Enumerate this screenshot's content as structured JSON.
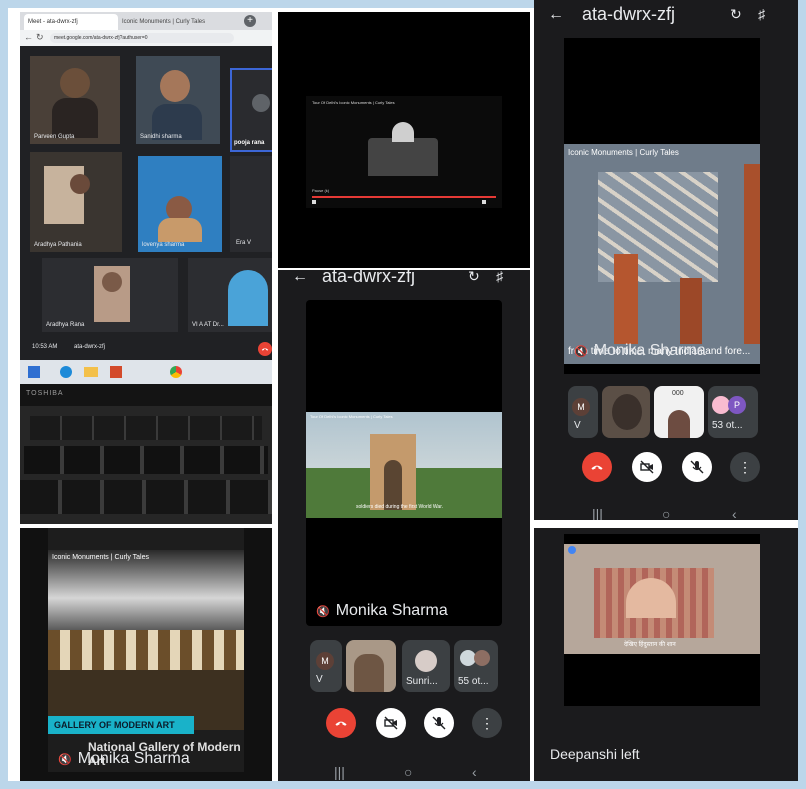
{
  "laptop": {
    "tab_title": "Meet - ata-dwrx-zfj",
    "tab2_title": "Iconic Monuments | Curly Tales",
    "url": "meet.google.com/ata-dwrx-zfj?authuser=0",
    "participants": [
      "Parveen Gupta",
      "Sanidhi sharma",
      "pooja rana",
      "Aradhya Pathania",
      "lovenya sharma",
      "Era V",
      "Aradhya Rana",
      "VI A AT Dr..."
    ],
    "time": "10:53 AM",
    "meeting_code": "ata-dwrx-zfj",
    "brand": "TOSHIBA"
  },
  "panel2": {
    "video_title": "Tour Of Delhi's Iconic Monuments | Curly Tales",
    "subtitle": "Pause (k)"
  },
  "phone_center": {
    "header": "ata-dwrx-zfj",
    "video_title": "Tour Of Delhi's Iconic Monuments | Curly Tales",
    "caption": "soldiers died during the first World War.",
    "presenter": "Monika Sharma",
    "tiles": [
      {
        "label": "V",
        "initial": "M"
      },
      {
        "label": ""
      },
      {
        "label": "Sunri..."
      },
      {
        "label": "55 ot..."
      }
    ]
  },
  "phone_right": {
    "header": "ata-dwrx-zfj",
    "video_title": "Iconic Monuments | Curly Tales",
    "caption": "from time to time, many Indian and fore...",
    "presenter": "Monika Sharma",
    "tiles": [
      {
        "label": "V",
        "initial": "M"
      },
      {
        "label": ""
      },
      {
        "label": "000"
      },
      {
        "label": "53 ot...",
        "initial": "P"
      }
    ]
  },
  "panel_gallery": {
    "video_title": "Iconic Monuments | Curly Tales",
    "banner": "GALLERY OF MODERN ART",
    "caption": "National Gallery of Modern Art",
    "presenter": "Monika Sharma"
  },
  "panel_deepanshi": {
    "caption": "देखिए हिंदुस्तान की शान",
    "status": "Deepanshi left"
  },
  "colors": {
    "meet_dark": "#202124",
    "tile_gray": "#3c4043",
    "end_call_red": "#ea4335",
    "brand_blue": "#1a73e8"
  }
}
